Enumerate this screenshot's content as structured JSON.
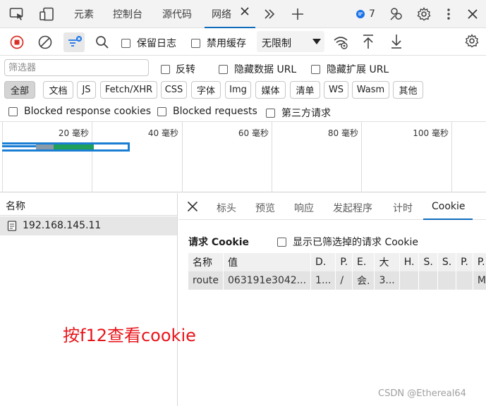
{
  "tabbar": {
    "tabs": [
      "元素",
      "控制台",
      "源代码",
      "网络"
    ],
    "active_tab": "网络",
    "issues_count": "7"
  },
  "toolbar": {
    "preserve_log_label": "保留日志",
    "disable_cache_label": "禁用缓存",
    "throttle_value": "无限制"
  },
  "filter": {
    "placeholder": "筛选器",
    "invert_label": "反转",
    "hide_data_url_label": "隐藏数据 URL",
    "hide_ext_url_label": "隐藏扩展 URL"
  },
  "types": [
    "全部",
    "文档",
    "JS",
    "Fetch/XHR",
    "CSS",
    "字体",
    "Img",
    "媒体",
    "清单",
    "WS",
    "Wasm",
    "其他"
  ],
  "active_type": "全部",
  "blocked": {
    "blocked_cookies_label": "Blocked response cookies",
    "blocked_requests_label": "Blocked requests",
    "third_party_label": "第三方请求"
  },
  "timeline": {
    "ticks": [
      "20 毫秒",
      "40 毫秒",
      "60 毫秒",
      "80 毫秒",
      "100 毫秒"
    ],
    "colors": {
      "bar": "#1a7fd4",
      "queue": "#8a9aa8",
      "wait": "#1fa05a"
    }
  },
  "request_list": {
    "header": "名称",
    "rows": [
      {
        "name": "192.168.145.11"
      }
    ]
  },
  "details": {
    "tabs": [
      "标头",
      "预览",
      "响应",
      "发起程序",
      "计时",
      "Cookie"
    ],
    "active_tab": "Cookie",
    "section_title": "请求 Cookie",
    "show_filtered_label": "显示已筛选掉的请求 Cookie",
    "cookie_table": {
      "columns": [
        "名称",
        "值",
        "D.",
        "P.",
        "E.",
        "大",
        "H.",
        "S.",
        "S.",
        "P.",
        "P."
      ],
      "rows": [
        [
          "route",
          "063191e3042...",
          "1...",
          "/",
          "会.",
          "3...",
          "",
          "",
          "",
          "",
          "M."
        ]
      ]
    }
  },
  "annotation": "按f12查看cookie",
  "watermark": "CSDN @Ethereal64"
}
